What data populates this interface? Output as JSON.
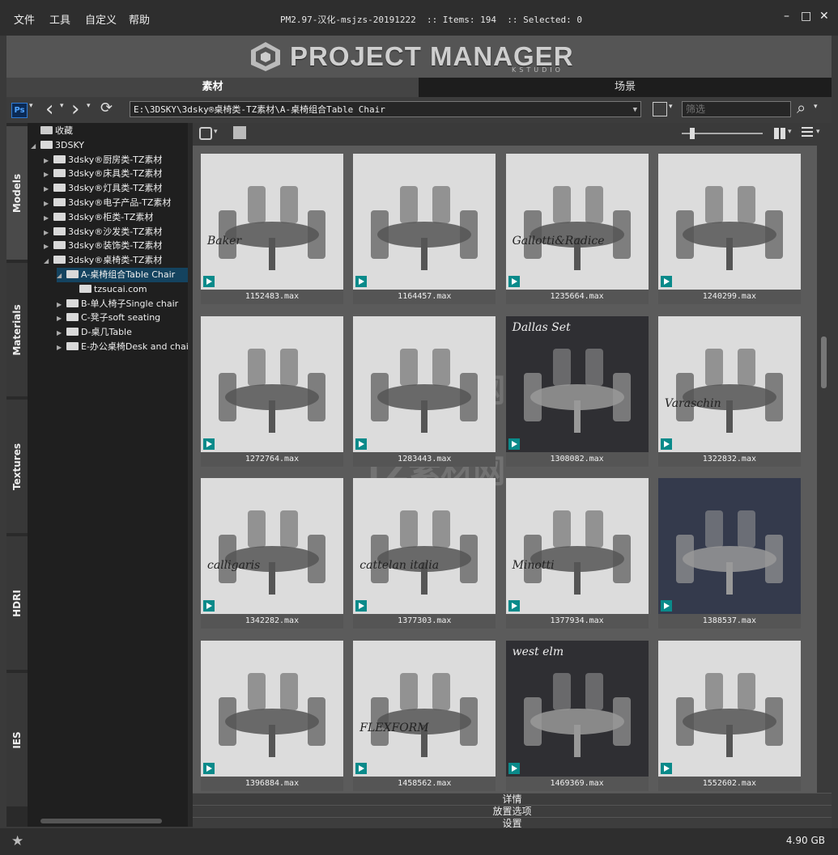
{
  "menu": [
    "文件",
    "工具",
    "自定义",
    "帮助"
  ],
  "title": "PM2.97-汉化-msjzs-20191222  :: Items: 194  :: Selected: 0",
  "window_buttons": [
    "–",
    "□",
    "✕"
  ],
  "logo": {
    "text": "PROJECT MANAGER",
    "sub": "KSTUDIO"
  },
  "tabs": [
    "素材",
    "场景"
  ],
  "toolbar": {
    "ps_label": "Ps",
    "back_icon": "‹",
    "forward_icon": "›",
    "refresh_icon": "⟳",
    "path": "E:\\3DSKY\\3dsky®桌椅类-TZ素材\\A-桌椅组合Table Chair",
    "filter_placeholder": "筛选",
    "search_icon": "⌕"
  },
  "side_tabs": [
    "Models",
    "Materials",
    "Textures",
    "HDRI",
    "IES"
  ],
  "tree": [
    {
      "label": "收藏",
      "level": 0,
      "tri": "",
      "icon": "star"
    },
    {
      "label": "3DSKY",
      "level": 0,
      "tri": "◢"
    },
    {
      "label": "3dsky®厨房类-TZ素材",
      "level": 1,
      "tri": "▶"
    },
    {
      "label": "3dsky®床具类-TZ素材",
      "level": 1,
      "tri": "▶"
    },
    {
      "label": "3dsky®灯具类-TZ素材",
      "level": 1,
      "tri": "▶"
    },
    {
      "label": "3dsky®电子产品-TZ素材",
      "level": 1,
      "tri": "▶"
    },
    {
      "label": "3dsky®柜类-TZ素材",
      "level": 1,
      "tri": "▶"
    },
    {
      "label": "3dsky®沙发类-TZ素材",
      "level": 1,
      "tri": "▶"
    },
    {
      "label": "3dsky®装饰类-TZ素材",
      "level": 1,
      "tri": "▶"
    },
    {
      "label": "3dsky®桌椅类-TZ素材",
      "level": 1,
      "tri": "◢"
    },
    {
      "label": "A-桌椅组合Table Chair",
      "level": 2,
      "tri": "◢",
      "selected": true
    },
    {
      "label": "tzsucai.com",
      "level": 3,
      "tri": ""
    },
    {
      "label": "B-单人椅子Single chair",
      "level": 2,
      "tri": "▶"
    },
    {
      "label": "C-凳子soft seating",
      "level": 2,
      "tri": "▶"
    },
    {
      "label": "D-桌几Table",
      "level": 2,
      "tri": "▶"
    },
    {
      "label": "E-办公桌椅Desk and chair",
      "level": 2,
      "tri": "▶"
    }
  ],
  "items": [
    {
      "name": "1152483.max",
      "bg": "light",
      "brand": "Baker"
    },
    {
      "name": "1164457.max",
      "bg": "light",
      "brand": ""
    },
    {
      "name": "1235664.max",
      "bg": "light",
      "brand": "Gallotti&Radice"
    },
    {
      "name": "1240299.max",
      "bg": "light",
      "brand": ""
    },
    {
      "name": "1272764.max",
      "bg": "light",
      "brand": ""
    },
    {
      "name": "1283443.max",
      "bg": "light",
      "brand": ""
    },
    {
      "name": "1308082.max",
      "bg": "dark",
      "brand": "Dallas Set"
    },
    {
      "name": "1322832.max",
      "bg": "light",
      "brand": "Varaschin"
    },
    {
      "name": "1342282.max",
      "bg": "light",
      "brand": "calligaris"
    },
    {
      "name": "1377303.max",
      "bg": "light",
      "brand": "cattelan italia"
    },
    {
      "name": "1377934.max",
      "bg": "light",
      "brand": "Minotti"
    },
    {
      "name": "1388537.max",
      "bg": "navy",
      "brand": ""
    },
    {
      "name": "1396884.max",
      "bg": "light",
      "brand": ""
    },
    {
      "name": "1458562.max",
      "bg": "light",
      "brand": "FLEXFORM"
    },
    {
      "name": "1469369.max",
      "bg": "dark",
      "brand": "west elm"
    },
    {
      "name": "1552602.max",
      "bg": "light",
      "brand": ""
    }
  ],
  "panels": [
    "详情",
    "放置选项",
    "设置"
  ],
  "status": {
    "size": "4.90 GB",
    "star": "★"
  },
  "colors": {
    "accent": "#14435f",
    "max_icon": "#0a8a8a"
  }
}
